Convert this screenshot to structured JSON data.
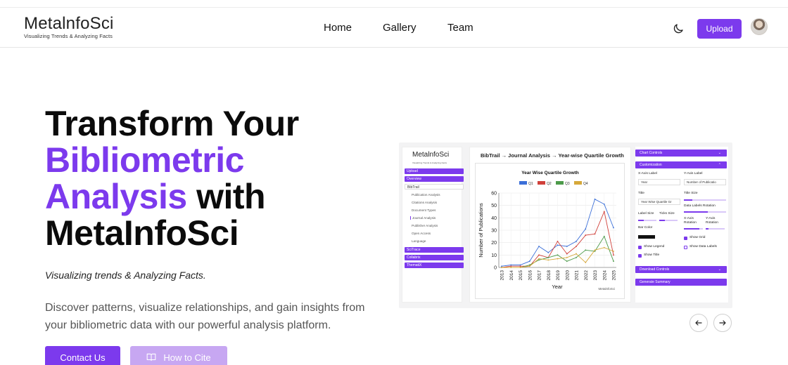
{
  "header": {
    "logo_text": "MetalnfoSci",
    "logo_subtitle": "Visualizing Trends & Analyzing Facts",
    "nav": [
      {
        "label": "Home"
      },
      {
        "label": "Gallery"
      },
      {
        "label": "Team"
      }
    ],
    "upload_label": "Upload"
  },
  "hero": {
    "title_line1": "Transform Your",
    "title_accent1": "Bibliometric",
    "title_accent2": "Analysis",
    "title_line3_rest": " with",
    "title_line4": "MetaInfoSci",
    "tagline": "Visualizing trends & Analyzing Facts.",
    "description": "Discover patterns, visualize relationships, and gain insights from your bibliometric data with our powerful analysis platform.",
    "contact_label": "Contact Us",
    "cite_label": "How to Cite"
  },
  "preview": {
    "logo_text": "MetalnfoSci",
    "logo_subtitle": "Visualizing Trends & Analyzing Facts",
    "sidebar": {
      "upload": "Upload",
      "overview": "Overview",
      "bibtrail": "BibTrail",
      "bibtrail_items": [
        "Publication Analysis",
        "Citations Analysis",
        "Document Types",
        "Journal Analysis",
        "Publisher Analysis",
        "Open Access",
        "Language"
      ],
      "scitrace": "SciTrace",
      "collabrix": "Collabrix",
      "thematix": "ThematiX"
    },
    "breadcrumb": "BibTrail → Journal Analysis → Year-wise Quartile Growth",
    "controls": {
      "chart_controls": "Chart Controls",
      "customization": "Customization",
      "x_axis_label": "X-Axis Label",
      "y_axis_label": "Y-Axis Label",
      "x_axis_value": "Year",
      "y_axis_value": "Number of Publicatio",
      "title_label": "Title",
      "title_size_label": "Title Size",
      "title_value": "Year Wise Quartile Gr",
      "data_labels_rotation": "Data Labels Rotation",
      "label_size": "Label Size",
      "ticks_size": "Ticks Size",
      "x_axis_rotation": "X-Axis Rotation",
      "y_axis_rotation": "Y-Axis Rotation",
      "bar_color": "Bar Color",
      "show_grid": "Show Grid",
      "show_legend": "Show Legend",
      "show_data_labels": "Show Data Labels",
      "show_title": "Show Title",
      "download_controls": "Download Controls",
      "generate_summary": "Generate Summary"
    },
    "watermark": "MetalnfoSci"
  },
  "chart_data": {
    "type": "line",
    "title": "Year Wise Quartile Growth",
    "xlabel": "Year",
    "ylabel": "Number of Publications",
    "ylim": [
      0,
      60
    ],
    "yticks": [
      0,
      10,
      20,
      30,
      40,
      50,
      60
    ],
    "x": [
      "2013",
      "2014",
      "2015",
      "2016",
      "2017",
      "2018",
      "2019",
      "2020",
      "2021",
      "2022",
      "2023",
      "2024",
      "2025"
    ],
    "series": [
      {
        "name": "Q1",
        "color": "#3b6fd8",
        "values": [
          1,
          2,
          2,
          5,
          17,
          12,
          18,
          17,
          21,
          31,
          55,
          51,
          32
        ]
      },
      {
        "name": "Q2",
        "color": "#d0403a",
        "values": [
          0,
          1,
          1,
          1,
          10,
          8,
          21,
          11,
          17,
          26,
          27,
          45,
          10
        ]
      },
      {
        "name": "Q3",
        "color": "#4c9a4a",
        "values": [
          0,
          0,
          0,
          2,
          6,
          8,
          10,
          5,
          8,
          14,
          13,
          25,
          5
        ]
      },
      {
        "name": "Q4",
        "color": "#d6a83a",
        "values": [
          0,
          0,
          0,
          1,
          7,
          6,
          7,
          8,
          11,
          4,
          14,
          16,
          13
        ]
      }
    ],
    "legend": "top-center",
    "grid": true
  },
  "colors": {
    "accent": "#7c3aed",
    "accent_light": "#c7a7f2"
  }
}
